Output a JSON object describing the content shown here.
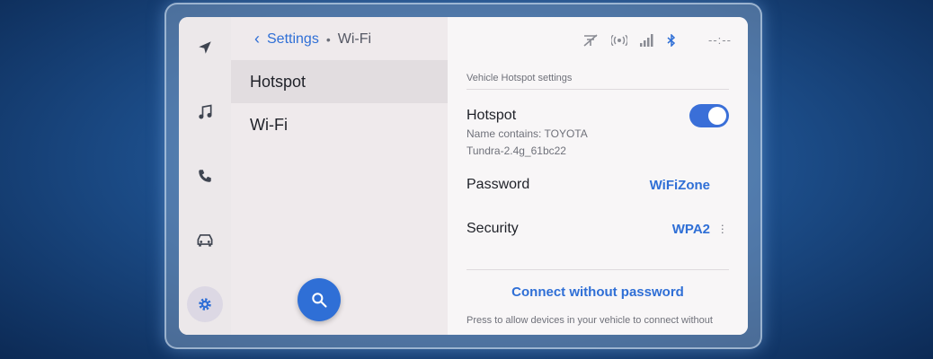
{
  "breadcrumb": {
    "parent": "Settings",
    "separator": "•",
    "current": "Wi-Fi"
  },
  "left_menu": {
    "items": [
      {
        "label": "Hotspot",
        "selected": true
      },
      {
        "label": "Wi-Fi",
        "selected": false
      }
    ]
  },
  "rail": {
    "items": [
      "navigation-icon",
      "music-icon",
      "phone-icon",
      "car-icon",
      "gear-icon"
    ],
    "active": "gear-icon"
  },
  "status_bar": {
    "icons": [
      "no-signal-icon",
      "broadcast-icon",
      "signal-bars-icon",
      "bluetooth-icon"
    ],
    "clock": "--:--"
  },
  "main": {
    "section_heading": "Vehicle Hotspot settings",
    "hotspot": {
      "label": "Hotspot",
      "sub_line1": "Name contains: TOYOTA",
      "sub_line2": "Tundra-2.4g_61bc22",
      "enabled": true
    },
    "password": {
      "label": "Password",
      "value": "WiFiZone"
    },
    "security": {
      "label": "Security",
      "value": "WPA2"
    },
    "connect_button": "Connect without password",
    "footnote": "Press to allow devices in your vehicle to connect without"
  },
  "colors": {
    "accent": "#2f6fd6",
    "toggle_on": "#3a6fd8"
  }
}
